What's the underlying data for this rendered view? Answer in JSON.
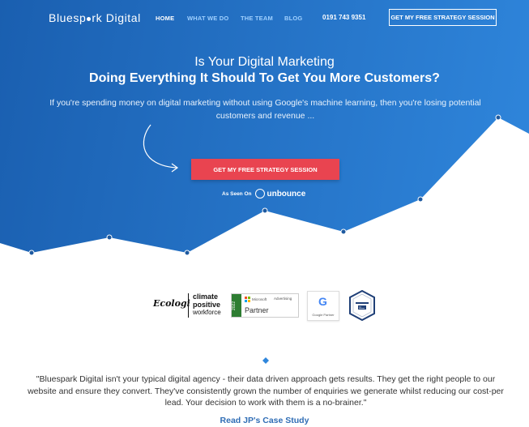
{
  "nav": {
    "logo_text_a": "Bluesp",
    "logo_text_b": "rk Digital",
    "links": [
      "HOME",
      "WHAT WE DO",
      "THE TEAM",
      "BLOG"
    ],
    "phone": "0191 743 9351",
    "cta": "GET MY FREE STRATEGY SESSION"
  },
  "hero": {
    "headline_line1": "Is Your Digital Marketing",
    "headline_line2": "Doing Everything It Should To Get You More Customers?",
    "subheadline": "If you're spending money on digital marketing without using Google's machine learning, then you're losing potential customers and revenue ...",
    "cta": "GET MY FREE STRATEGY SESSION",
    "as_seen_on": "As Seen On",
    "unbounce": "unbounce"
  },
  "badges": {
    "ecologi": "Ecologi",
    "climate_line1": "climate",
    "climate_line2": "positive",
    "climate_line3": "workforce",
    "ms_year": "2022",
    "ms_brand": "Microsoft",
    "ms_advertising": "Advertising",
    "ms_partner": "Partner",
    "google_partner": "Google Partner"
  },
  "testimonial": {
    "quote": "\"Bluespark Digital isn't your typical digital agency - their data driven approach gets results. They get the right people to our website and ensure they convert. They've consistently grown the number of enquiries we generate whilst reducing our cost-per lead. Your decision to work with them is a no-brainer.\"",
    "link": "Read JP's Case Study"
  },
  "colors": {
    "hero_blue": "#2471c4",
    "cta_red": "#e94450",
    "link_blue": "#2f6db5",
    "nav_link": "#9fd0ff"
  }
}
